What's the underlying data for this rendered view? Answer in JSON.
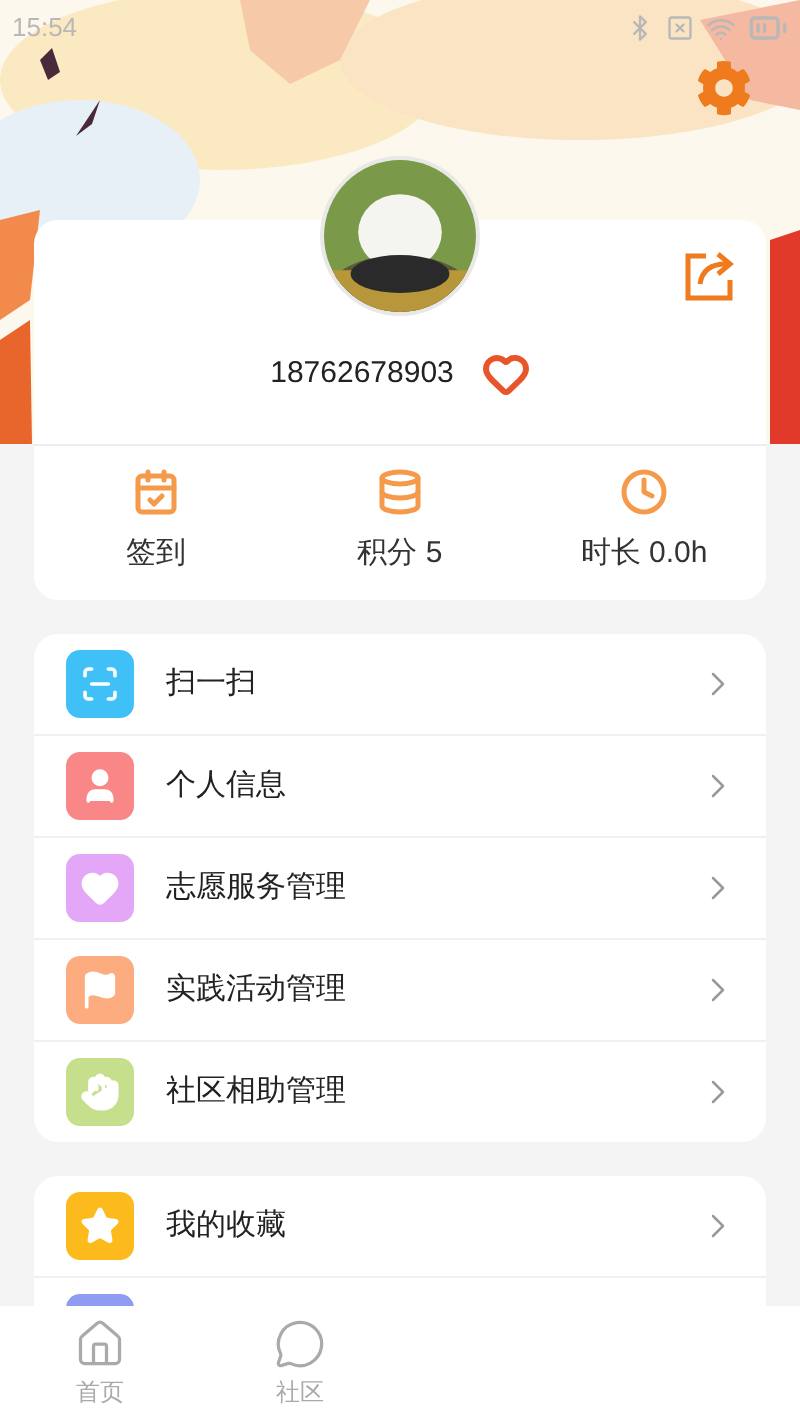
{
  "status_bar": {
    "time": "15:54"
  },
  "profile": {
    "phone": "18762678903"
  },
  "stats": [
    {
      "kind": "checkin",
      "label": "签到"
    },
    {
      "kind": "points",
      "label": "积分 5"
    },
    {
      "kind": "duration",
      "label": "时长 0.0h"
    }
  ],
  "menu_groups": [
    {
      "items": [
        {
          "kind": "scan",
          "label": "扫一扫",
          "color": "#3fc1f7"
        },
        {
          "kind": "person",
          "label": "个人信息",
          "color": "#f98787"
        },
        {
          "kind": "heart",
          "label": "志愿服务管理",
          "color": "#e4a6f7"
        },
        {
          "kind": "flag",
          "label": "实践活动管理",
          "color": "#fcac7e"
        },
        {
          "kind": "hand",
          "label": "社区相助管理",
          "color": "#c5df8d"
        }
      ]
    },
    {
      "items": [
        {
          "kind": "star",
          "label": "我的收藏",
          "color": "#fcba1c"
        },
        {
          "kind": "chart",
          "color": "#8f9cf2"
        }
      ]
    }
  ],
  "bottom_nav": [
    {
      "kind": "home",
      "label": "首页",
      "selected": false
    },
    {
      "kind": "community",
      "label": "社区",
      "selected": false
    }
  ]
}
